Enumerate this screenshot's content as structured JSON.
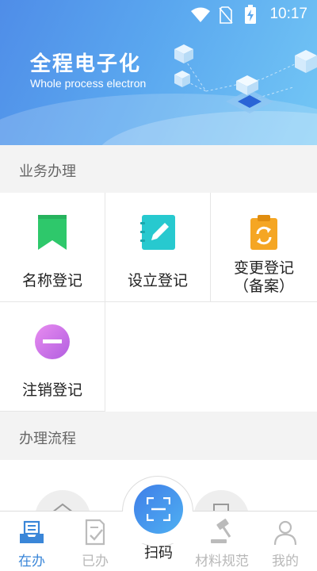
{
  "status_bar": {
    "time": "10:17"
  },
  "banner": {
    "title": "全程电子化",
    "subtitle": "Whole process electron"
  },
  "sections": {
    "business": "业务办理",
    "process": "办理流程"
  },
  "services": [
    {
      "label": "名称登记",
      "icon": "bookmark-icon",
      "color": "#2ec86b"
    },
    {
      "label": "设立登记",
      "icon": "notebook-edit-icon",
      "color": "#27c9cf"
    },
    {
      "label_line1": "变更登记",
      "label_line2": "（备案）",
      "icon": "clipboard-refresh-icon",
      "color": "#f5a623"
    },
    {
      "label": "注销登记",
      "icon": "minus-circle-icon",
      "color": "#c96ce6"
    }
  ],
  "tabs": [
    {
      "label": "在办",
      "icon": "inbox-tray-icon",
      "active": true
    },
    {
      "label": "已办",
      "icon": "checked-document-icon"
    },
    {
      "label": "扫码",
      "icon": "scan-icon"
    },
    {
      "label": "材料规范",
      "icon": "gavel-icon"
    },
    {
      "label": "我的",
      "icon": "user-icon"
    }
  ],
  "colors": {
    "accent": "#3a86d8",
    "tab_inactive": "#b8b8b8"
  }
}
